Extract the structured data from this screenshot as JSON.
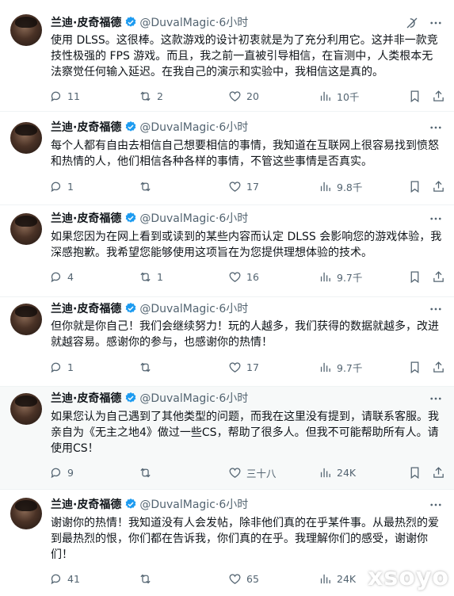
{
  "author": {
    "name": "兰迪·皮奇福德",
    "handle": "@DuvalMagic",
    "dot": "·",
    "time": "6小时"
  },
  "tweets": [
    {
      "text": "使用 DLSS。这很棒。这款游戏的设计初衷就是为了充分利用它。这并非一款竞技性极强的 FPS 游戏。而且，我之前一直被引导相信，在盲测中，人类根本无法察觉任何输入延迟。在我自己的演示和实验中，我相信这是真的。",
      "replies": "11",
      "retweets": "2",
      "likes": "20",
      "views": "10千"
    },
    {
      "text": "每个人都有自由去相信自己想要相信的事情，我知道在互联网上很容易找到愤怒和热情的人，他们相信各种各样的事情，不管这些事情是否真实。",
      "replies": "1",
      "retweets": "",
      "likes": "17",
      "views": "9.8千"
    },
    {
      "text": "如果您因为在网上看到或读到的某些内容而认定 DLSS 会影响您的游戏体验，我深感抱歉。我希望您能够使用这项旨在为您提供理想体验的技术。",
      "replies": "4",
      "retweets": "1",
      "likes": "16",
      "views": "9.7千"
    },
    {
      "text": "但你就是你自己！我们会继续努力！玩的人越多，我们获得的数据就越多，改进就越容易。感谢你的参与，也感谢你的热情！",
      "replies": "1",
      "retweets": "",
      "likes": "17",
      "views": "9.7千"
    },
    {
      "text": "如果您认为自己遇到了其他类型的问题，而我在这里没有提到，请联系客服。我亲自为《无主之地4》做过一些CS，帮助了很多人。但我不可能帮助所有人。请使用CS！",
      "replies": "9",
      "retweets": "",
      "likes": "三十八",
      "views": "24K"
    },
    {
      "text": "谢谢你的热情！我知道没有人会发帖，除非他们真的在乎某件事。从最热烈的爱到最热烈的恨，你们都在告诉我，你们真的在乎。我理解你们的感受，谢谢你们！",
      "replies": "41",
      "retweets": "",
      "likes": "65",
      "views": "24K"
    }
  ],
  "watermark": "xsoyo",
  "colors": {
    "verified": "#1d9bf0",
    "muted": "#536471",
    "highlight_bg": "#f7f9f9"
  },
  "icons": [
    "verified-badge-icon",
    "more-icon",
    "grok-icon",
    "reply-icon",
    "retweet-icon",
    "like-icon",
    "views-icon",
    "bookmark-icon",
    "share-icon"
  ]
}
